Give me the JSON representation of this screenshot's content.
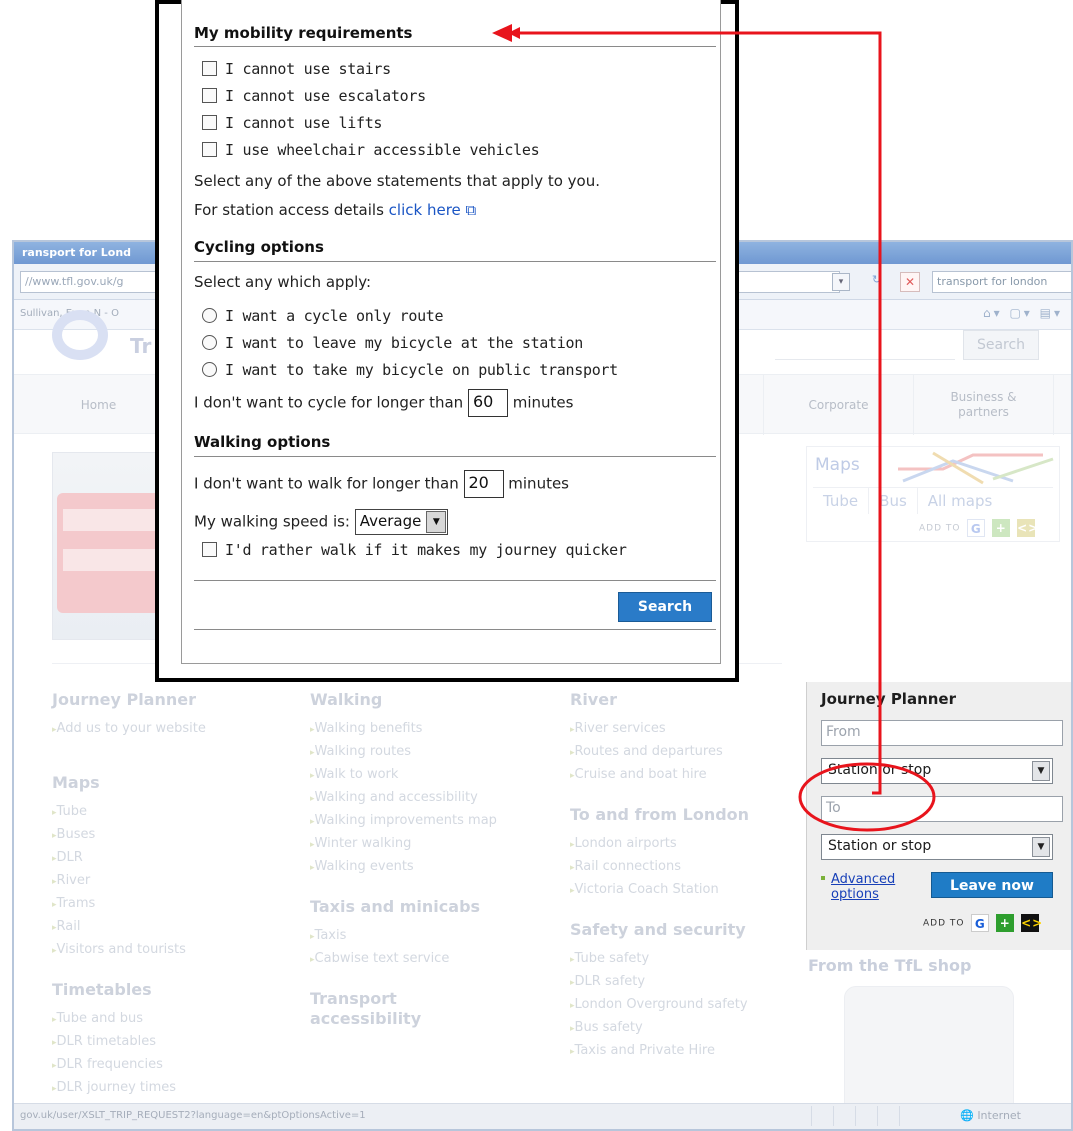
{
  "browser": {
    "title": "ransport for Lond",
    "url": "//www.tfl.gov.uk/g",
    "search_text": "transport for london",
    "favorites_text": "Sullivan, Evan N - O",
    "status_url": "gov.uk/user/XSLT_TRIP_REQUEST2?language=en&ptOptionsActive=1",
    "status_zone": "Internet"
  },
  "site": {
    "logo_text": "Tr",
    "search_button": "Search",
    "nav": [
      "Home",
      "Corporate",
      "Business & partners"
    ],
    "maps": {
      "title": "Maps",
      "links": [
        "Tube",
        "Bus",
        "All maps"
      ],
      "add_to": "ADD TO"
    },
    "journey_planner": {
      "title": "Journey Planner",
      "from_placeholder": "From",
      "from_select": "Station or stop",
      "to_placeholder": "To",
      "to_select": "Station or stop",
      "advanced_options": "Advanced options",
      "leave_now": "Leave now",
      "add_to": "ADD TO"
    },
    "shop_title": "From the TfL shop",
    "columns": [
      {
        "sections": [
          {
            "title": "Journey Planner",
            "links": [
              "Add us to your website"
            ]
          },
          {
            "title": "Maps",
            "links": [
              "Tube",
              "Buses",
              "DLR",
              "River",
              "Trams",
              "Rail",
              "Visitors and tourists"
            ]
          },
          {
            "title": "Timetables",
            "links": [
              "Tube and bus",
              "DLR timetables",
              "DLR frequencies",
              "DLR journey times"
            ]
          }
        ]
      },
      {
        "sections": [
          {
            "title": "Walking",
            "links": [
              "Walking benefits",
              "Walking routes",
              "Walk to work",
              "Walking and accessibility",
              "Walking improvements map",
              "Winter walking",
              "Walking events"
            ]
          },
          {
            "title": "Taxis and minicabs",
            "links": [
              "Taxis",
              "Cabwise text service"
            ]
          },
          {
            "title": "Transport accessibility",
            "links": []
          }
        ]
      },
      {
        "sections": [
          {
            "title": "River",
            "links": [
              "River services",
              "Routes and departures",
              "Cruise and boat hire"
            ]
          },
          {
            "title": "To and from London",
            "links": [
              "London airports",
              "Rail connections",
              "Victoria Coach Station"
            ]
          },
          {
            "title": "Safety and security",
            "links": [
              "Tube safety",
              "DLR safety",
              "London Overground safety",
              "Bus safety",
              "Taxis and Private Hire"
            ]
          }
        ]
      }
    ]
  },
  "popup": {
    "mobility": {
      "title": "My mobility requirements",
      "options": [
        "I cannot use stairs",
        "I cannot use escalators",
        "I cannot use lifts",
        "I use wheelchair accessible vehicles"
      ],
      "hint": "Select any of the above statements that apply to you.",
      "access_prefix": "For station access details",
      "access_link": "click here"
    },
    "cycling": {
      "title": "Cycling options",
      "prompt": "Select any which apply:",
      "options": [
        "I want a cycle only route",
        "I want to leave my bicycle at the station",
        "I want to take my bicycle on public transport"
      ],
      "max_prefix": "I don't want to cycle for longer than",
      "max_value": "60",
      "max_suffix": "minutes"
    },
    "walking": {
      "title": "Walking options",
      "max_prefix": "I don't want to walk for longer than",
      "max_value": "20",
      "max_suffix": "minutes",
      "speed_label": "My walking speed is:",
      "speed_value": "Average",
      "quicker": "I'd rather walk if it makes my journey quicker"
    },
    "search_button": "Search"
  },
  "colors": {
    "annotation": "#e8141c",
    "leave_now": "#1f7cc6",
    "link": "#1a55c4"
  }
}
